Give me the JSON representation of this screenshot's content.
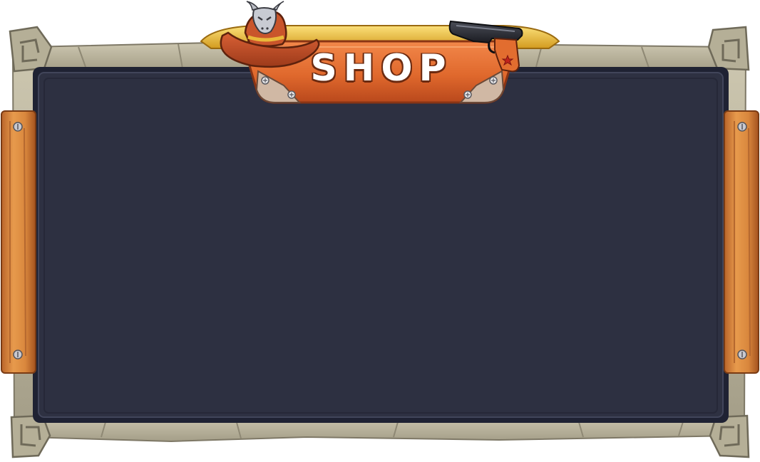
{
  "panel": {
    "title": "SHOP"
  },
  "decorations": {
    "left_icon": "cowboy-hat-icon",
    "hat_badge_icon": "bull-skull-icon",
    "right_icon": "pistol-icon",
    "grip_emblem_icon": "star-icon"
  },
  "colors": {
    "panel_background": "#2e3142",
    "panel_inner_border": "#1f2233",
    "stone_frame": "#b8b29a",
    "stone_shadow": "#8e8874",
    "wood_plank": "#d9873d",
    "title_plate": "#e0692d",
    "title_plate_dark": "#a8421a",
    "gold_trim": "#e9b93a",
    "hat": "#c24f28"
  }
}
